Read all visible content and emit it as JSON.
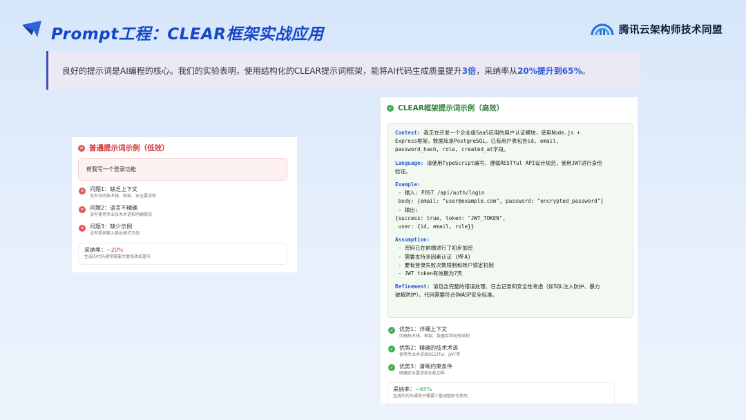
{
  "header": {
    "title": "Prompt工程：CLEAR框架实战应用",
    "brand": "腾讯云架构师技术同盟"
  },
  "intro": {
    "text_before": "良好的提示词是AI编程的核心。我们的实验表明，使用结构化的CLEAR提示词框架，能将AI代码生成质量提升",
    "highlight1": "3倍",
    "text_middle": "，采纳率从",
    "highlight2": "20%提升到65%",
    "text_after": "。"
  },
  "bad_example": {
    "title": "普通提示词示例（低效）",
    "prompt": "帮我写一个登录功能",
    "issues": [
      {
        "title": "问题1：缺乏上下文",
        "desc": "没有说明技术栈、框架、安全要求等"
      },
      {
        "title": "问题2：语言不精确",
        "desc": "没有使用专业技术术语和明确需求"
      },
      {
        "title": "问题3：缺少示例",
        "desc": "没有提供输入输出格式示例"
      }
    ],
    "rate_label": "采纳率：",
    "rate_value": "~20%",
    "rate_desc": "生成的代码通常需要大量修改或重写"
  },
  "good_example": {
    "title": "CLEAR框架提示词示例（高效）",
    "context_key": "Context:",
    "context_lines": [
      " 我正在开发一个企业级SaaS应用的用户认证模块，使用Node.js +",
      "Express框架，数据库是PostgreSQL。已有用户表包含id, email,",
      "password_hash, role, created_at字段。"
    ],
    "language_key": "Language:",
    "language_lines": [
      " 请使用TypeScript编写，遵循RESTful API设计规范，使用JWT进行身份",
      "验证。"
    ],
    "example_key": "Example:",
    "example_lines": [
      " - 输入: POST /api/auth/login",
      " body: {email: \"user@example.com\", password: \"encrypted_password\"}",
      " - 输出:",
      "{success: true, token: \"JWT_TOKEN\",",
      " user: {id, email, role}}"
    ],
    "assumption_key": "Assumption:",
    "assumption_lines": [
      " - 密码已在前端进行了初步加密",
      " - 需要支持多因素认证 (MFA)",
      " - 要有登录失败次数限制和账户锁定机制",
      " - JWT token有效期为7天"
    ],
    "refinement_key": "Refinement:",
    "refinement_lines": [
      " 请包含完整的错误处理、日志记录和安全性考虑（如SQL注入防护、暴力",
      "破解防护）。代码需要符合OWASP安全标准。"
    ],
    "advantages": [
      {
        "title": "优势1：详细上下文",
        "desc": "明确技术栈、框架、数据库和现有结构"
      },
      {
        "title": "优势2：精确的技术术语",
        "desc": "使用专业术语如RESTful、JWT等"
      },
      {
        "title": "优势3：清晰约束条件",
        "desc": "明确安全要求和功能边界"
      }
    ],
    "rate_label": "采纳率：",
    "rate_value": "~65%",
    "rate_desc": "生成的代码通常只需要少量调整即可使用"
  },
  "colors": {
    "title_blue": "#1747c8",
    "accent_red": "#d03535",
    "accent_green": "#3fae55",
    "highlight_blue": "#2f58d6"
  }
}
